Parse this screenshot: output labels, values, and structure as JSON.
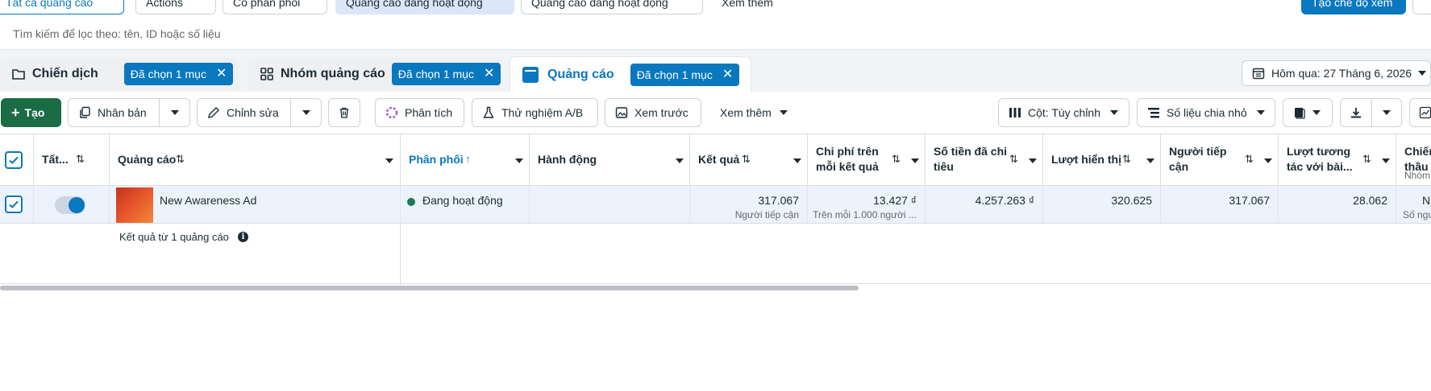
{
  "top_bar": {
    "chips": [
      "Tất cả quảng cáo",
      "Actions",
      "Có phân phối",
      "Quảng cáo đang hoạt động",
      "Quảng cáo đang hoạt động",
      "Xem thêm",
      "Tạo chế độ xem"
    ]
  },
  "search": {
    "placeholder": "Tìm kiếm để lọc theo: tên, ID hoặc số liệu"
  },
  "tabs": [
    {
      "label": "Chiến dịch",
      "chip": "Đã chọn 1 mục"
    },
    {
      "label": "Nhóm quảng cáo",
      "chip": "Đã chọn 1 mục"
    },
    {
      "label": "Quảng cáo",
      "chip": "Đã chọn 1 mục"
    }
  ],
  "date_range": "Hôm qua: 27 Tháng 6, 2026",
  "toolbar": {
    "create": "Tạo",
    "duplicate": "Nhân bản",
    "edit": "Chỉnh sửa",
    "analyze": "Phân tích",
    "ab_test": "Thử nghiệm A/B",
    "preview": "Xem trước",
    "more": "Xem thêm",
    "columns": "Cột: Tùy chỉnh",
    "breakdown": "Số liệu chia nhỏ"
  },
  "columns": {
    "all": "Tất...",
    "ad": "Quảng cáo",
    "delivery": "Phân phối",
    "actions": "Hành động",
    "results": "Kết quả",
    "cost_per_result": "Chi phí trên mỗi kết quả",
    "amount_spent": "Số tiền đã chi tiêu",
    "impressions": "Lượt hiển thị",
    "reach": "Người tiếp cận",
    "engagement": "Lượt tương tác với bài...",
    "bid": "Chiến thầu",
    "bid_sub": "Nhóm"
  },
  "row": {
    "name": "New Awareness Ad",
    "delivery": "Đang hoạt động",
    "results": "317.067",
    "results_sub": "Người tiếp cận",
    "cost_per_result": "13.427 ₫",
    "cost_sub": "Trên mỗi 1.000 người ...",
    "amount_spent": "4.257.263 ₫",
    "impressions": "320.625",
    "reach": "317.067",
    "engagement": "28.062",
    "bid_value": "N",
    "bid_sub": "Số ngu"
  },
  "footer": {
    "summary": "Kết quả từ 1 quảng cáo"
  },
  "colors": {
    "accent": "#0a78be",
    "create": "#1b6b45",
    "row_bg": "#ecf3fc",
    "active_dot": "#1a7a5a"
  }
}
